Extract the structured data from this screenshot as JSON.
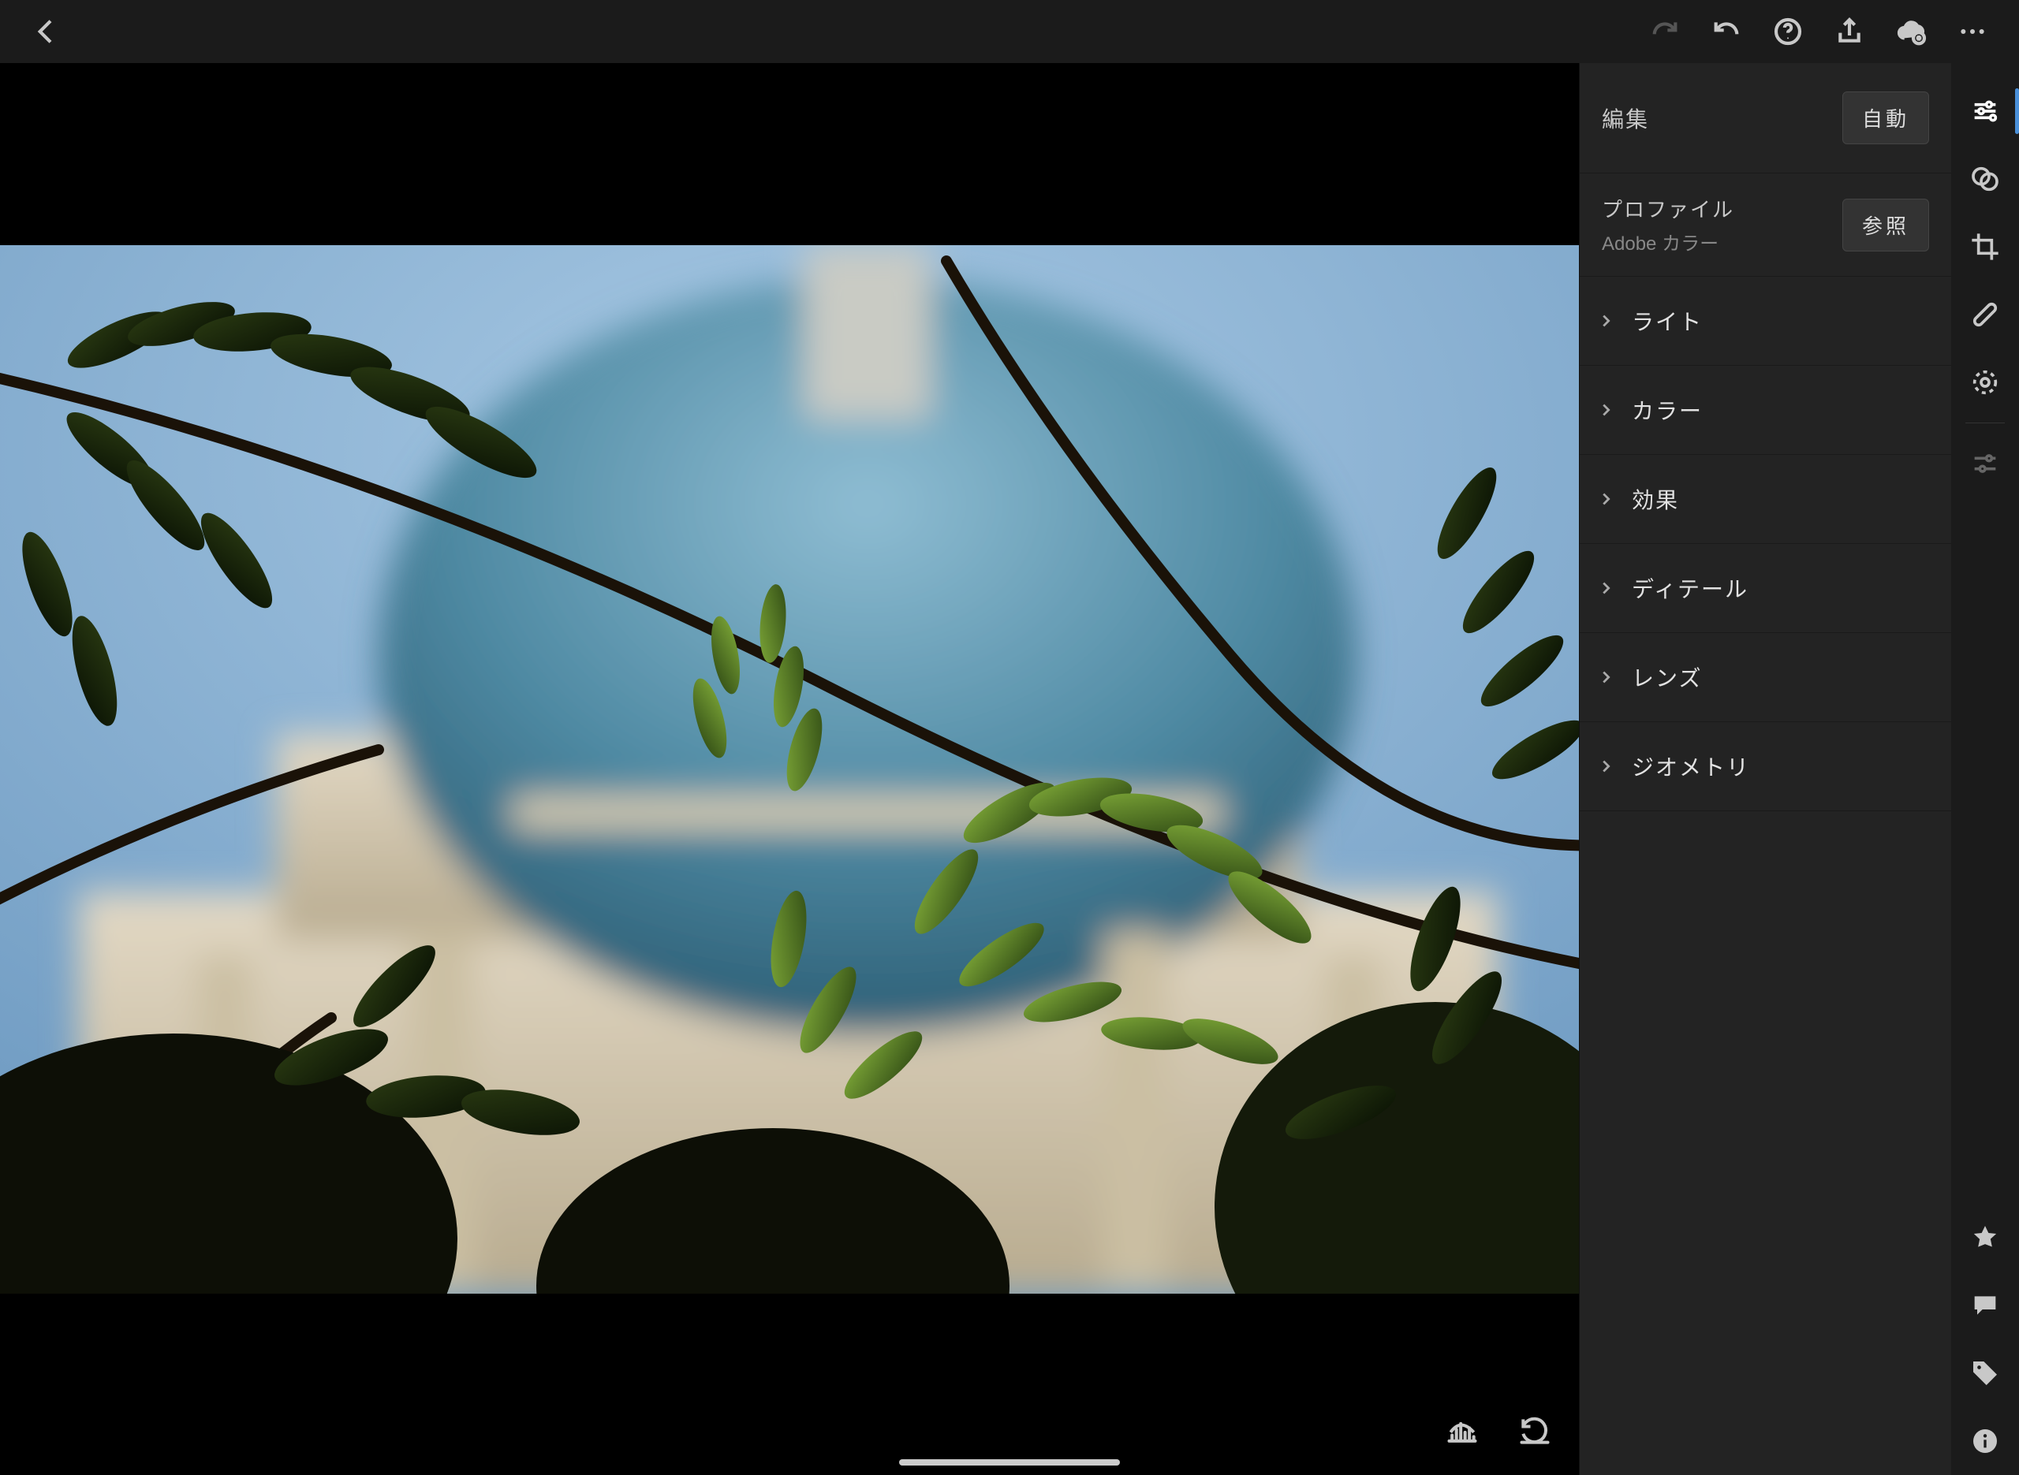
{
  "topbar": {
    "back": "back",
    "redo": "redo",
    "undo": "undo",
    "help": "help",
    "share": "share",
    "cloud": "cloud",
    "more": "more"
  },
  "panel": {
    "edit_label": "編集",
    "auto_label": "自動",
    "profile_label": "プロファイル",
    "profile_value": "Adobe カラー",
    "browse_label": "参照",
    "sections": [
      "ライト",
      "カラー",
      "効果",
      "ディテール",
      "レンズ",
      "ジオメトリ"
    ]
  },
  "tools": {
    "edit": "sliders-icon",
    "presets": "presets-icon",
    "crop": "crop-icon",
    "healing": "healing-icon",
    "masking": "masking-icon",
    "versions": "versions-icon",
    "star": "star-icon",
    "comment": "comment-icon",
    "tag": "tag-icon",
    "info": "info-icon"
  },
  "footer": {
    "histogram": "histogram-icon",
    "reset": "reset-icon"
  }
}
